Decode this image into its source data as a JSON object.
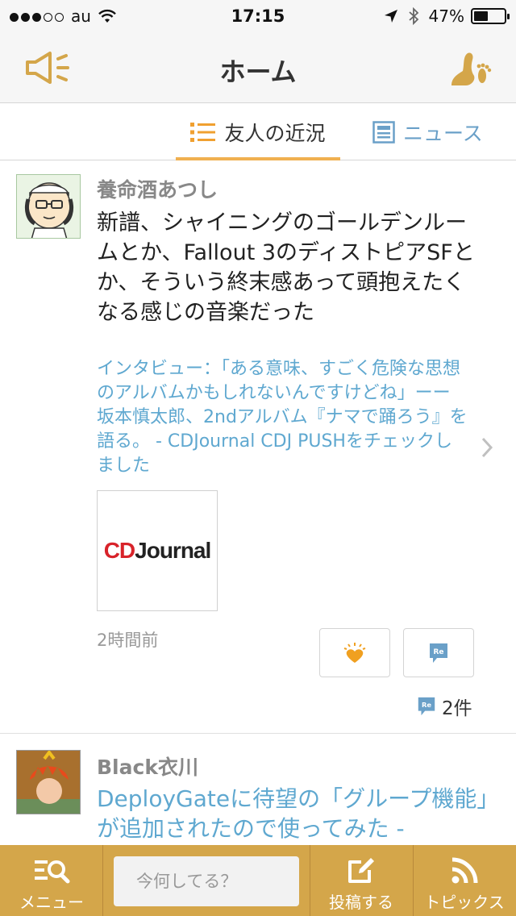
{
  "status_bar": {
    "carrier": "au",
    "time": "17:15",
    "battery": "47%",
    "battery_level": 0.47
  },
  "nav": {
    "title": "ホーム",
    "left_icon": "megaphone-icon",
    "right_icon": "footprint-icon"
  },
  "tabs": [
    {
      "label": "友人の近況",
      "icon": "list-icon",
      "active": true
    },
    {
      "label": "ニュース",
      "icon": "newspaper-icon",
      "active": false
    }
  ],
  "feed": [
    {
      "username": "養命酒あつし",
      "text": "新譜、シャイニングのゴールデンルームとか、Fallout 3のディストピアSFとか、そういう終末感あって頭抱えたくなる感じの音楽だった",
      "link_text": "インタビュー：「ある意味、すごく危険な思想のアルバムかもしれないんですけどね」ーー坂本慎太郎、2ndアルバム『ナマで踊ろう』を語る。 - CDJournal CDJ PUSHをチェックしました",
      "thumbnail_logo_red": "CD",
      "thumbnail_logo_dark": "Journal",
      "timestamp": "2時間前",
      "reply_count": "2件"
    },
    {
      "username": "Black衣川",
      "link_text": "DeployGateに待望の「グループ機能」が追加されたので使ってみた -"
    }
  ],
  "toolbar": {
    "menu_label": "メニュー",
    "input_placeholder": "今何してる？",
    "post_label": "投稿する",
    "topics_label": "トピックス"
  },
  "colors": {
    "accent": "#d4a64a",
    "link": "#5fa8d0",
    "tab_underline": "#f0b050",
    "like": "#f0a020"
  }
}
